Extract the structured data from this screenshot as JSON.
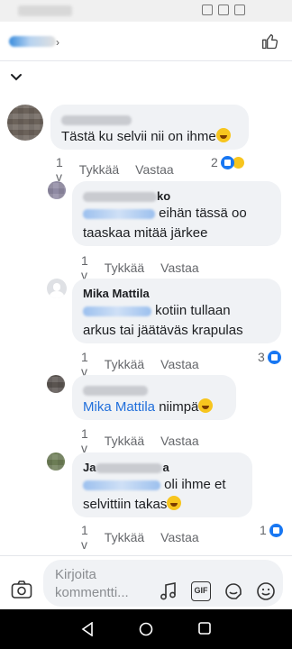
{
  "header": {
    "like_icon": "thumbs-up-icon"
  },
  "comments": [
    {
      "text_prefix": "Tästä ku selvii nii on ihme",
      "time": "1 v",
      "like": "Tykkää",
      "reply": "Vastaa",
      "reaction_count": "2"
    },
    {
      "name_suffix": "ko",
      "text_a": "eihän tässä oo",
      "text_b": "taaskaa mitää järkee",
      "time": "1 v",
      "like": "Tykkää",
      "reply": "Vastaa"
    },
    {
      "author": "Mika Mattila",
      "text_a": "kotiin tullaan",
      "text_b": "arkus tai jäätäväs krapulas",
      "time": "1 v",
      "like": "Tykkää",
      "reply": "Vastaa",
      "reaction_count": "3"
    },
    {
      "mention": "Mika Mattila",
      "text_a": "niimpä",
      "time": "1 v",
      "like": "Tykkää",
      "reply": "Vastaa"
    },
    {
      "name_prefix": "Ja",
      "name_suffix": "a",
      "text_a": "oli ihme et",
      "text_b": "selvittiin takas",
      "time": "1 v",
      "like": "Tykkää",
      "reply": "Vastaa",
      "reaction_count": "1"
    }
  ],
  "composer": {
    "placeholder_line1": "Kirjoita",
    "placeholder_line2": "kommentti...",
    "gif_label": "GIF"
  }
}
